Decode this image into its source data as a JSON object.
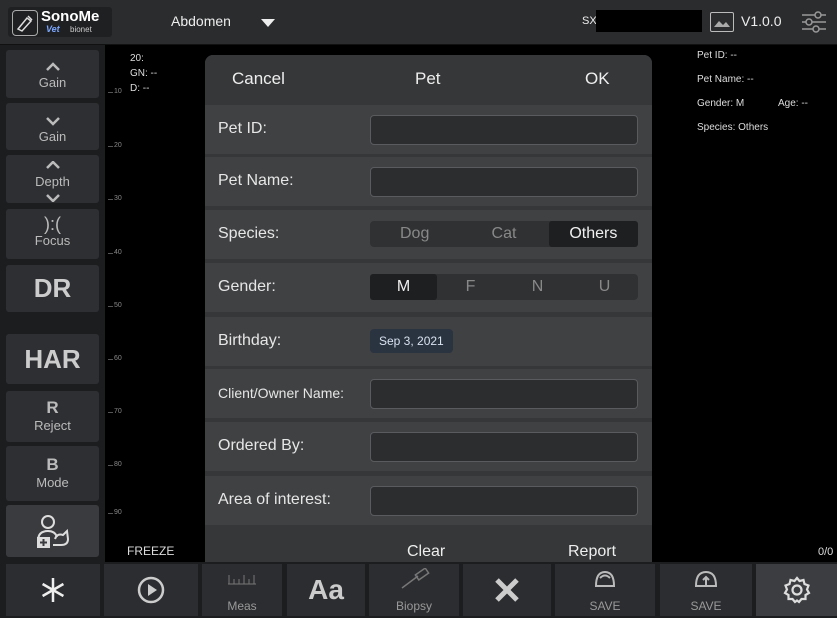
{
  "topbar": {
    "brand_main": "SonoMe",
    "brand_sub": "Vet",
    "brand_sub2": "bionet",
    "preset": "Abdomen",
    "probe": "SX-",
    "version": "V1.0.0"
  },
  "left_panel": {
    "gain_up_label": "Gain",
    "gain_down_label": "Gain",
    "depth_label": "Depth",
    "focus_symbol": "):(",
    "focus_label": "Focus",
    "dr_label": "DR",
    "har_label": "HAR",
    "reject_symbol": "R",
    "reject_label": "Reject",
    "mode_symbol": "B",
    "mode_label": "Mode"
  },
  "scale": {
    "ticks": [
      "10",
      "20",
      "30",
      "40",
      "50",
      "60",
      "70",
      "80",
      "90"
    ]
  },
  "image_info": {
    "line1": "20:",
    "gain": "GN: --",
    "depth": "D: --"
  },
  "patient_info": {
    "pet_id": "Pet ID: --",
    "pet_name": "Pet Name: --",
    "gender": "Gender: M",
    "age": "Age: --",
    "species": "Species: Others"
  },
  "status": {
    "freeze": "FREEZE",
    "frame_count": "0/0"
  },
  "dialog": {
    "cancel": "Cancel",
    "title": "Pet",
    "ok": "OK",
    "pet_id_label": "Pet ID:",
    "pet_id_value": "",
    "pet_name_label": "Pet Name:",
    "pet_name_value": "",
    "species_label": "Species:",
    "species_options": [
      "Dog",
      "Cat",
      "Others"
    ],
    "species_selected": "Others",
    "gender_label": "Gender:",
    "gender_options": [
      "M",
      "F",
      "N",
      "U"
    ],
    "gender_selected": "M",
    "birthday_label": "Birthday:",
    "birthday_value": "Sep 3, 2021",
    "client_label": "Client/Owner Name:",
    "client_value": "",
    "ordered_by_label": "Ordered By:",
    "ordered_by_value": "",
    "area_label": "Area of interest:",
    "area_value": "",
    "clear": "Clear",
    "report": "Report"
  },
  "bottombar": {
    "meas_label": "Meas",
    "annot_symbol": "Aa",
    "biopsy_label": "Biopsy",
    "save_image_label": "SAVE",
    "save_cine_label": "SAVE"
  }
}
